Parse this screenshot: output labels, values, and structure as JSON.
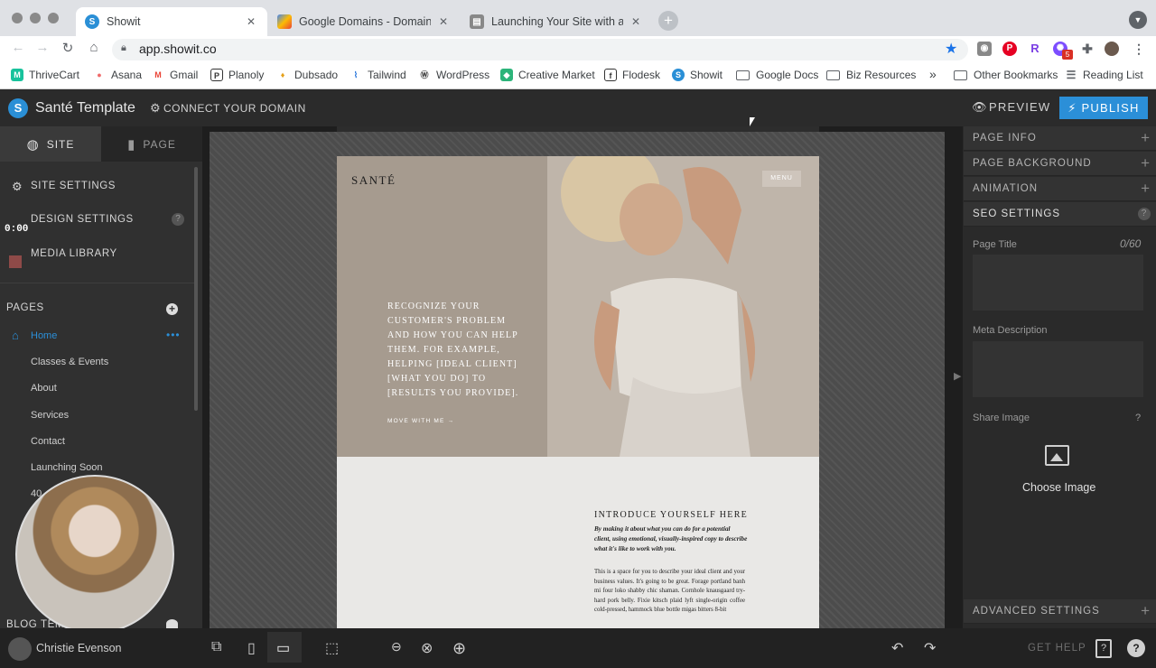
{
  "browser": {
    "tabs": [
      {
        "title": "Showit",
        "active": true,
        "icon": "showit-icon"
      },
      {
        "title": "Google Domains - Domain overview",
        "active": false,
        "icon": "google-domains-icon"
      },
      {
        "title": "Launching Your Site with a New Domain",
        "active": false,
        "icon": "book-icon"
      }
    ],
    "url": "app.showit.co",
    "bookmarks": [
      "ThriveCart",
      "Asana",
      "Gmail",
      "Planoly",
      "Dubsado",
      "Tailwind",
      "WordPress",
      "Creative Market",
      "Flodesk",
      "Showit",
      "Google Docs",
      "Biz Resources"
    ],
    "more": "»",
    "other_bookmarks": "Other Bookmarks",
    "reading_list": "Reading List",
    "extension_badge": "5"
  },
  "app": {
    "site_name": "Santé Template",
    "connect_domain": "CONNECT YOUR DOMAIN",
    "preview": "PREVIEW",
    "publish": "PUBLISH",
    "timer": "0:00"
  },
  "left": {
    "tab_site": "SITE",
    "tab_page": "PAGE",
    "items": [
      "SITE SETTINGS",
      "DESIGN SETTINGS",
      "MEDIA LIBRARY"
    ],
    "pages_header": "PAGES",
    "pages": [
      "Home",
      "Classes & Events",
      "About",
      "Services",
      "Contact",
      "Launching Soon",
      "40"
    ],
    "blog_header": "BLOG TEM",
    "user": "Christie Evenson"
  },
  "canvas": {
    "brand": "SANTÉ",
    "menu": "MENU",
    "hero_copy": "RECOGNIZE YOUR CUSTOMER'S PROBLEM AND HOW YOU CAN HELP THEM. FOR EXAMPLE, HELPING [IDEAL CLIENT] [WHAT YOU DO] TO [RESULTS YOU PROVIDE].",
    "cta": "MOVE WITH ME →",
    "intro_heading": "INTRODUCE YOURSELF HERE",
    "intro_sub": "By making it about what you can do for a potential client, using emotional, visually-inspired copy to describe what it's like to work with you.",
    "intro_body": "This is a space for you to describe your ideal client and your business values. It's going to be great. Forage portland banh mi four loko shabby chic shaman. Cornhole knausgaard try-hard pork belly. Fixie kitsch plaid lyft single-origin coffee cold-pressed, hammock blue bottle migas bitters 8-bit"
  },
  "right": {
    "sections": [
      "PAGE INFO",
      "PAGE BACKGROUND",
      "ANIMATION",
      "SEO SETTINGS"
    ],
    "page_title_label": "Page Title",
    "page_title_count": "0/60",
    "meta_label": "Meta Description",
    "share_label": "Share Image",
    "share_help": "?",
    "choose_image": "Choose Image",
    "advanced": "ADVANCED SETTINGS"
  },
  "bottom": {
    "get_help": "GET HELP"
  }
}
